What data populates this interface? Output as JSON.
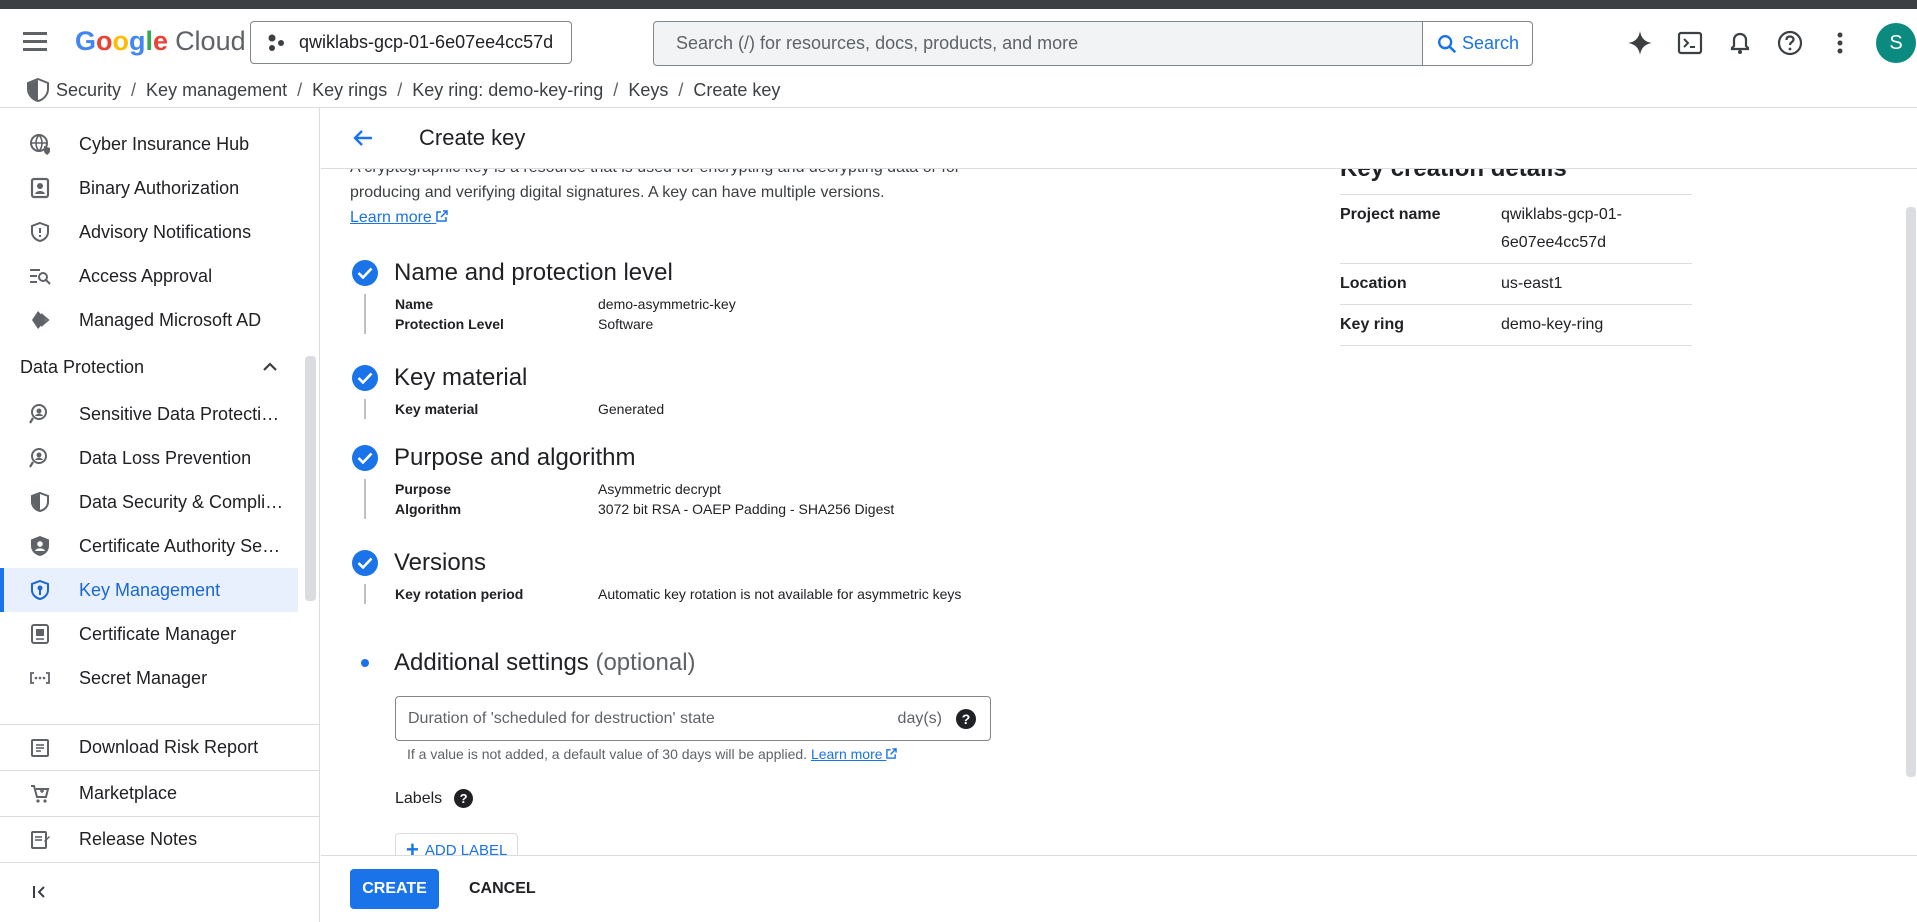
{
  "header": {
    "logo_google": "Google",
    "logo_cloud": "Cloud",
    "project": "qwiklabs-gcp-01-6e07ee4cc57d",
    "search_placeholder": "Search (/) for resources, docs, products, and more",
    "search_button": "Search",
    "avatar_letter": "S"
  },
  "breadcrumb": [
    "Security",
    "Key management",
    "Key rings",
    "Key ring: demo-key-ring",
    "Keys",
    "Create key"
  ],
  "sidebar": {
    "items": [
      {
        "label": "Cyber Insurance Hub",
        "icon": "globe-shield-icon"
      },
      {
        "label": "Binary Authorization",
        "icon": "badge-icon"
      },
      {
        "label": "Advisory Notifications",
        "icon": "shield-alert-icon"
      },
      {
        "label": "Access Approval",
        "icon": "list-search-icon"
      },
      {
        "label": "Managed Microsoft AD",
        "icon": "diamond-icon"
      }
    ],
    "section": "Data Protection",
    "section_items": [
      {
        "label": "Sensitive Data Protecti…",
        "icon": "search-person-icon"
      },
      {
        "label": "Data Loss Prevention",
        "icon": "search-person-icon"
      },
      {
        "label": "Data Security & Compli…",
        "icon": "shield-half-icon"
      },
      {
        "label": "Certificate Authority Se…",
        "icon": "shield-person-icon"
      },
      {
        "label": "Key Management",
        "icon": "shield-key-icon",
        "active": true
      },
      {
        "label": "Certificate Manager",
        "icon": "certificate-icon"
      },
      {
        "label": "Secret Manager",
        "icon": "secret-icon"
      }
    ],
    "bottom": [
      {
        "label": "Download Risk Report",
        "icon": "report-icon"
      },
      {
        "label": "Marketplace",
        "icon": "cart-icon"
      },
      {
        "label": "Release Notes",
        "icon": "notes-icon"
      }
    ]
  },
  "page": {
    "title": "Create key",
    "intro_line1": "A cryptographic key is a resource that is used for encrypting and decrypting data or for",
    "intro_line2": "producing and verifying digital signatures. A key can have multiple versions.",
    "learn_more": "Learn more"
  },
  "steps": [
    {
      "title": "Name and protection level",
      "rows": [
        {
          "k": "Name",
          "v": "demo-asymmetric-key"
        },
        {
          "k": "Protection Level",
          "v": "Software"
        }
      ]
    },
    {
      "title": "Key material",
      "rows": [
        {
          "k": "Key material",
          "v": "Generated"
        }
      ]
    },
    {
      "title": "Purpose and algorithm",
      "rows": [
        {
          "k": "Purpose",
          "v": "Asymmetric decrypt"
        },
        {
          "k": "Algorithm",
          "v": "3072 bit RSA - OAEP Padding - SHA256 Digest"
        }
      ]
    },
    {
      "title": "Versions",
      "rows": [
        {
          "k": "Key rotation period",
          "v": "Automatic key rotation is not available for asymmetric keys"
        }
      ]
    }
  ],
  "additional": {
    "title": "Additional settings",
    "optional": "(optional)",
    "duration_placeholder": "Duration of 'scheduled for destruction' state",
    "duration_unit": "day(s)",
    "hint": "If a value is not added, a default value of 30 days will be applied.",
    "hint_link": "Learn more",
    "labels": "Labels",
    "add_label": "ADD LABEL"
  },
  "details": {
    "title": "Key creation details",
    "rows": [
      {
        "k": "Project name",
        "v": "qwiklabs-gcp-01-6e07ee4cc57d"
      },
      {
        "k": "Location",
        "v": "us-east1"
      },
      {
        "k": "Key ring",
        "v": "demo-key-ring"
      }
    ]
  },
  "footer": {
    "create": "CREATE",
    "cancel": "CANCEL"
  },
  "colors": {
    "accent": "#1a73e8",
    "active_bg": "#e8f0fe"
  }
}
